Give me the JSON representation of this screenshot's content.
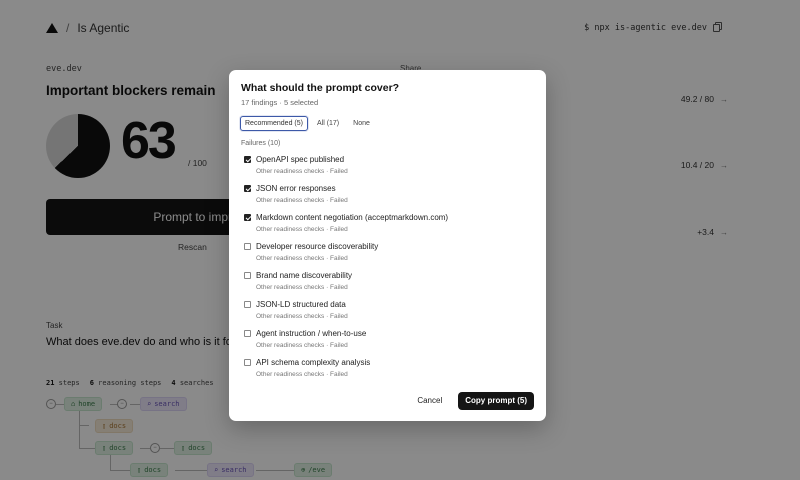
{
  "header": {
    "app_name": "Is Agentic",
    "separator": "/",
    "command": "$ npx is-agentic eve.dev"
  },
  "report": {
    "domain": "eve.dev",
    "share_label": "Share",
    "headline": "Important blockers remain",
    "score": "63",
    "score_max": "/ 100",
    "score_fraction": 0.63,
    "prompt_button": "Prompt to impro",
    "rescan": "Rescan",
    "metrics": [
      {
        "value": "49.2 / 80",
        "arrow": "→"
      },
      {
        "value": "10.4 / 20",
        "arrow": "→"
      },
      {
        "value": "+3.4",
        "arrow": "→"
      }
    ]
  },
  "task": {
    "label": "Task",
    "question": "What does eve.dev do and who is it for?",
    "steps_count": "21",
    "steps_label": "steps",
    "reasoning_count": "6",
    "reasoning_label": "reasoning steps",
    "searches_count": "4",
    "searches_label": "searches"
  },
  "graph": {
    "home": "home",
    "search1": "search",
    "docs1": "docs",
    "docs2": "docs",
    "docs3": "docs",
    "docs4": "docs",
    "search2": "search",
    "eve": "/eve"
  },
  "modal": {
    "title": "What should the prompt cover?",
    "subtitle": "17 findings · 5 selected",
    "segments": [
      "Recommended (5)",
      "All (17)",
      "None"
    ],
    "section_label": "Failures (10)",
    "items": [
      {
        "title": "OpenAPI spec published",
        "sub": "Other readiness checks · Failed",
        "checked": true
      },
      {
        "title": "JSON error responses",
        "sub": "Other readiness checks · Failed",
        "checked": true
      },
      {
        "title": "Markdown content negotiation (acceptmarkdown.com)",
        "sub": "Other readiness checks · Failed",
        "checked": true
      },
      {
        "title": "Developer resource discoverability",
        "sub": "Other readiness checks · Failed",
        "checked": false
      },
      {
        "title": "Brand name discoverability",
        "sub": "Other readiness checks · Failed",
        "checked": false
      },
      {
        "title": "JSON-LD structured data",
        "sub": "Other readiness checks · Failed",
        "checked": false
      },
      {
        "title": "Agent instruction / when-to-use",
        "sub": "Other readiness checks · Failed",
        "checked": false
      },
      {
        "title": "API schema complexity analysis",
        "sub": "Other readiness checks · Failed",
        "checked": false
      }
    ],
    "cancel": "Cancel",
    "copy": "Copy prompt (5)"
  }
}
